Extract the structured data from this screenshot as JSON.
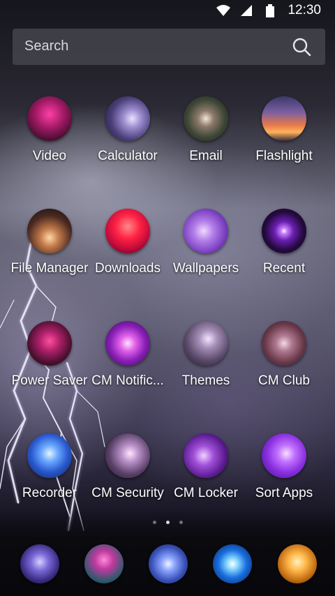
{
  "status_bar": {
    "time": "12:30",
    "icons": [
      "wifi-icon",
      "cell-signal-icon",
      "battery-icon"
    ]
  },
  "search": {
    "placeholder": "Search",
    "icon": "search-icon"
  },
  "apps": [
    {
      "label": "Video",
      "icon": "video-icon"
    },
    {
      "label": "Calculator",
      "icon": "calculator-icon"
    },
    {
      "label": "Email",
      "icon": "email-icon"
    },
    {
      "label": "Flashlight",
      "icon": "flashlight-icon"
    },
    {
      "label": "File Manager",
      "icon": "file-manager-icon"
    },
    {
      "label": "Downloads",
      "icon": "downloads-icon"
    },
    {
      "label": "Wallpapers",
      "icon": "wallpapers-icon"
    },
    {
      "label": "Recent",
      "icon": "recent-icon"
    },
    {
      "label": "Power Saver",
      "icon": "power-saver-icon"
    },
    {
      "label": "CM Notific...",
      "icon": "cm-notification-icon"
    },
    {
      "label": "Themes",
      "icon": "themes-icon"
    },
    {
      "label": "CM Club",
      "icon": "cm-club-icon"
    },
    {
      "label": "Recorder",
      "icon": "recorder-icon"
    },
    {
      "label": "CM Security",
      "icon": "cm-security-icon"
    },
    {
      "label": "CM Locker",
      "icon": "cm-locker-icon"
    },
    {
      "label": "Sort Apps",
      "icon": "sort-apps-icon"
    }
  ],
  "page_indicator": {
    "pages": 3,
    "current": 2
  },
  "dock": [
    {
      "icon": "dock-phone-icon"
    },
    {
      "icon": "dock-contacts-icon"
    },
    {
      "icon": "dock-app-drawer-icon"
    },
    {
      "icon": "dock-messages-icon"
    },
    {
      "icon": "dock-browser-icon"
    }
  ],
  "colors": {
    "search_bg": "#46485099",
    "label_text": "#ffffff",
    "accent_purple": "#8a3fd1",
    "accent_magenta": "#d0307a"
  }
}
